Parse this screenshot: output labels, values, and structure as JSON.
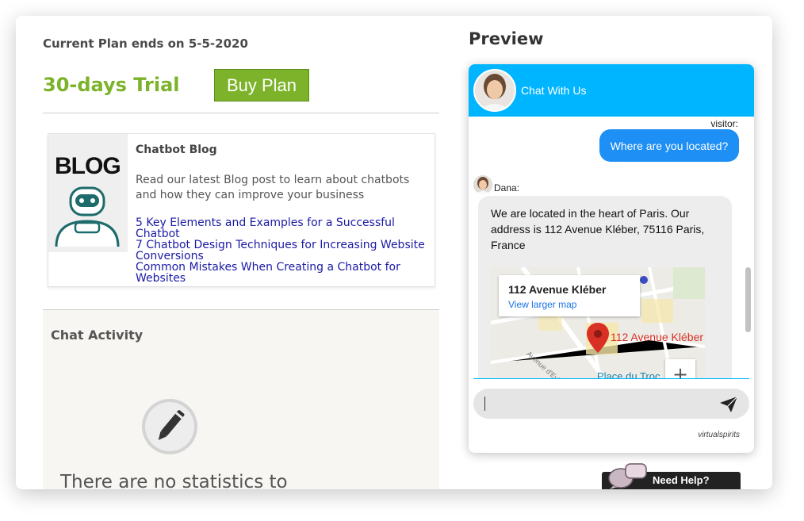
{
  "plan": {
    "ends_text": "Current Plan ends on 5-5-2020",
    "trial_label": "30-days Trial",
    "buy_button": "Buy Plan"
  },
  "blog": {
    "image_word": "BLOG",
    "title": "Chatbot Blog",
    "description": "Read our latest Blog post to learn about chatbots and how they can improve your business",
    "links": [
      "5 Key Elements and Examples for a Successful Chatbot",
      "7 Chatbot Design Techniques for Increasing Website Conversions",
      "Common Mistakes When Creating a Chatbot for Websites"
    ]
  },
  "activity": {
    "title": "Chat Activity",
    "empty_text": "There are no statistics to"
  },
  "preview": {
    "title": "Preview",
    "header_title": "Chat With Us",
    "visitor_label": "visitor:",
    "visitor_message": "Where are you located?",
    "agent_name": "Dana:",
    "agent_message": "We are located in the heart of Paris. Our address is 112 Avenue Kléber, 75116 Paris, France",
    "map": {
      "card_title": "112 Avenue Kléber",
      "card_link": "View larger map",
      "pin_label": "112 Avenue Kléber",
      "street_label": "Avenue d'Eylau",
      "place_label": "Place du Troc"
    },
    "input_value": "",
    "brand": "virtualspirits"
  },
  "help_button": "Need Help?",
  "colors": {
    "green": "#7cb32a",
    "chat_header": "#00b5ff",
    "visitor_bubble": "#1d8ff5",
    "link": "#1a1aa6",
    "pin": "#d93025"
  },
  "icons": [
    "robot-icon",
    "pencil-icon",
    "map-pin-icon",
    "send-icon",
    "chat-bubbles-icon"
  ]
}
